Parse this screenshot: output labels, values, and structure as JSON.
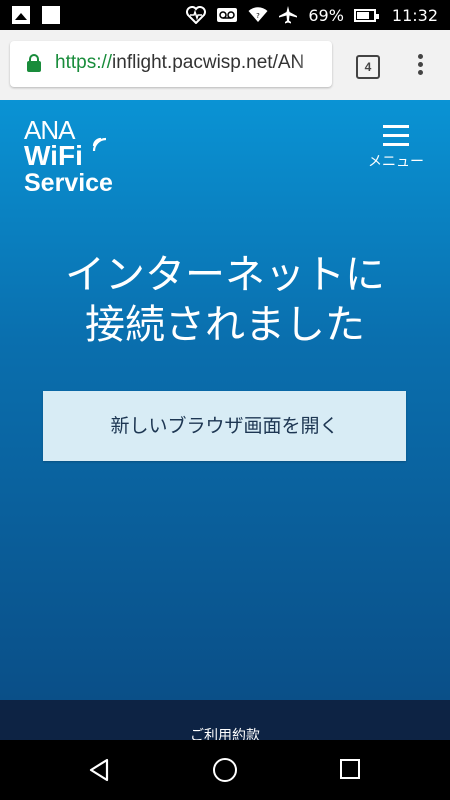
{
  "status_bar": {
    "battery_percent": "69%",
    "time": "11:32",
    "icons": [
      "image-icon",
      "notification-square-icon",
      "heart-monitor-icon",
      "voicemail-icon",
      "wifi-icon",
      "airplane-icon",
      "battery-icon"
    ]
  },
  "browser": {
    "url_scheme": "https://",
    "url_rest": "inflight.pacwisp.net/AN",
    "tab_count": "4"
  },
  "header": {
    "logo_line1": "ANA",
    "logo_line2": "WiFi",
    "logo_line3": "Service",
    "menu_label": "メニュー"
  },
  "main": {
    "headline_line1": "インターネットに",
    "headline_line2": "接続されました",
    "open_browser_button": "新しいブラウザ画面を開く"
  },
  "footer": {
    "terms_link": "ご利用約款"
  },
  "colors": {
    "accent_blue": "#0a93d4",
    "footer_navy": "#0d2344",
    "button_bg": "#d8ecf5",
    "secure_green": "#198c3b"
  }
}
